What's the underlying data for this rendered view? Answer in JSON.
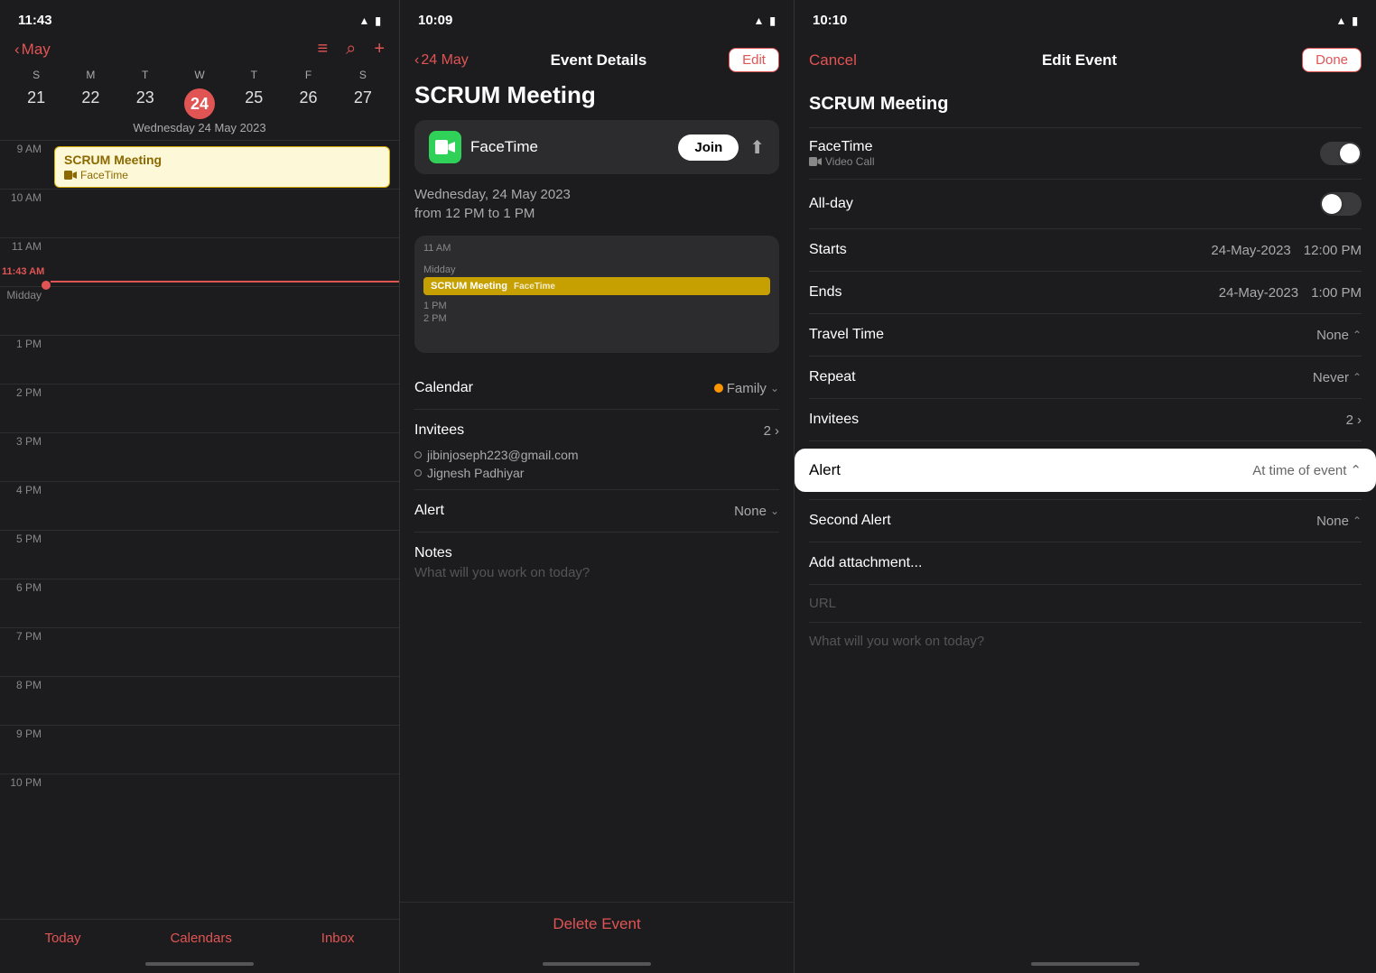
{
  "panel1": {
    "status": {
      "time": "11:43",
      "wifi": "wifi",
      "battery": "battery"
    },
    "nav": {
      "back_label": "May",
      "list_icon": "≡",
      "search_icon": "⌕",
      "add_icon": "+"
    },
    "week": {
      "days": [
        "S",
        "M",
        "T",
        "W",
        "T",
        "F",
        "S"
      ],
      "dates": [
        "21",
        "22",
        "23",
        "24",
        "25",
        "26",
        "27"
      ],
      "today_index": 3,
      "label": "Wednesday  24 May 2023"
    },
    "times": [
      "9 AM",
      "10 AM",
      "11 AM",
      "Midday",
      "1 PM",
      "2 PM",
      "3 PM",
      "4 PM",
      "5 PM",
      "6 PM",
      "7 PM",
      "8 PM",
      "9 PM",
      "10 PM"
    ],
    "current_time": "11:43 AM",
    "event": {
      "title": "SCRUM Meeting",
      "subtitle": "FaceTime"
    },
    "bottom_nav": {
      "today": "Today",
      "calendars": "Calendars",
      "inbox": "Inbox"
    }
  },
  "panel2": {
    "status": {
      "time": "10:09"
    },
    "header": {
      "back_label": "24 May",
      "title": "Event Details",
      "edit_label": "Edit"
    },
    "event_title": "SCRUM Meeting",
    "facetime": {
      "name": "FaceTime",
      "join_label": "Join"
    },
    "date": "Wednesday, 24 May 2023",
    "time_range": "from 12 PM to 1 PM",
    "mini_cal": {
      "time1": "11 AM",
      "midday": "Midday",
      "event_label": "SCRUM Meeting",
      "time2": "1 PM",
      "time3": "2 PM"
    },
    "calendar_row": {
      "label": "Calendar",
      "value": "Family"
    },
    "invitees_row": {
      "label": "Invitees",
      "count": "2",
      "email1": "jibinjoseph223@gmail.com",
      "email2": "Jignesh Padhiyar"
    },
    "alert_row": {
      "label": "Alert",
      "value": "None"
    },
    "notes_row": {
      "label": "Notes",
      "placeholder": "What will you work on today?"
    },
    "delete_label": "Delete Event"
  },
  "panel3": {
    "status": {
      "time": "10:10"
    },
    "header": {
      "cancel_label": "Cancel",
      "title": "Edit Event",
      "done_label": "Done"
    },
    "event_name": "SCRUM Meeting",
    "facetime_row": {
      "label": "FaceTime",
      "sublabel": "Video Call"
    },
    "allday_row": {
      "label": "All-day"
    },
    "starts_row": {
      "label": "Starts",
      "date": "24-May-2023",
      "time": "12:00 PM"
    },
    "ends_row": {
      "label": "Ends",
      "date": "24-May-2023",
      "time": "1:00 PM"
    },
    "travel_row": {
      "label": "Travel Time",
      "value": "None"
    },
    "repeat_row": {
      "label": "Repeat",
      "value": "Never"
    },
    "invitees_row": {
      "label": "Invitees",
      "count": "2"
    },
    "alert_row": {
      "label": "Alert",
      "value": "At time of event",
      "chevron": "⌃"
    },
    "second_alert_row": {
      "label": "Second Alert",
      "value": "None",
      "chevron": "⌃"
    },
    "attachment_row": {
      "label": "Add attachment..."
    },
    "url_placeholder": "URL",
    "notes_placeholder": "What will you work on today?"
  }
}
